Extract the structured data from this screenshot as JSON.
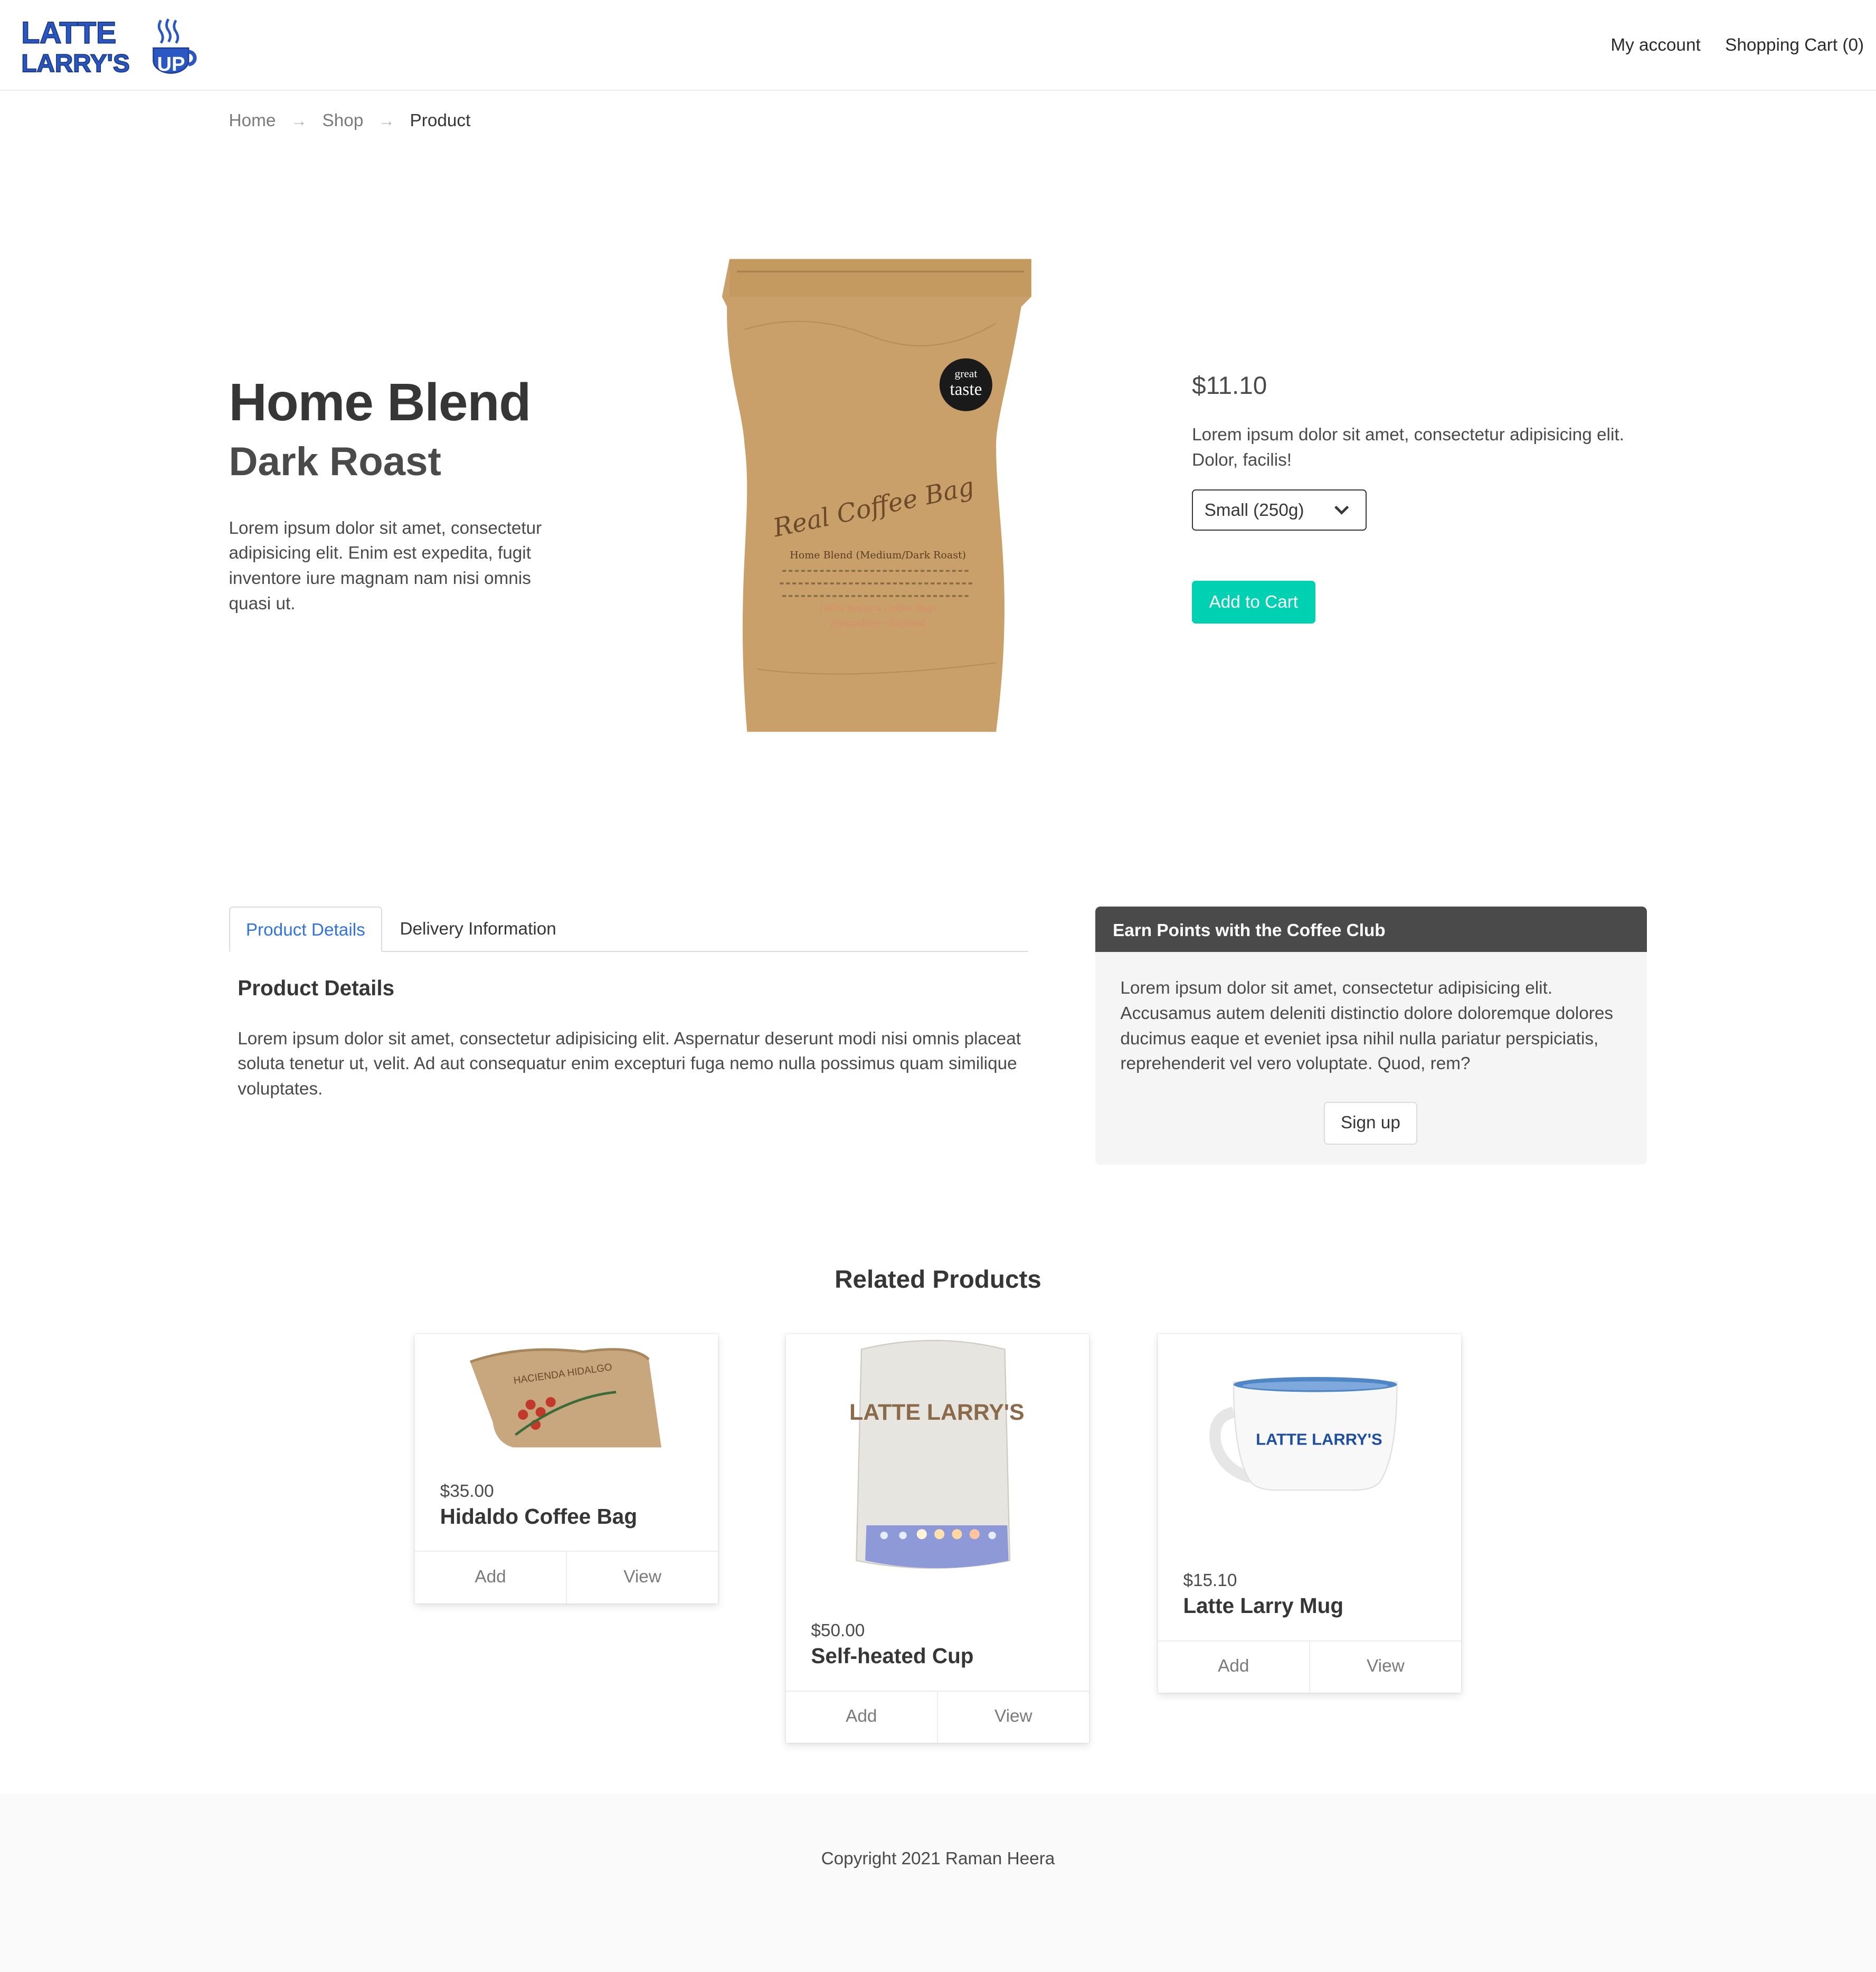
{
  "header": {
    "logo_line1": "LATTE",
    "logo_line2": "LARRY'S",
    "logo_cup_text": "UP",
    "my_account": "My account",
    "shopping_cart": "Shopping Cart (0)"
  },
  "breadcrumb": [
    "Home",
    "Shop",
    "Product"
  ],
  "product": {
    "title": "Home Blend",
    "subtitle": "Dark Roast",
    "description": "Lorem ipsum dolor sit amet, consectetur adipisicing elit. Enim est expedita, fugit inventore iure magnam nam nisi omnis quasi ut.",
    "image_label": {
      "badge_small": "great",
      "badge_big": "taste",
      "brand": "Real Coffee Bag",
      "line1": "Home Blend (Medium/Dark Roast)",
      "line2": "100% Arabica Coffee Bags",
      "line3": "Shropshire—England"
    },
    "price": "$11.10",
    "buy_description": "Lorem ipsum dolor sit amet, consectetur adipisicing elit. Dolor, facilis!",
    "size_selected": "Small (250g)",
    "add_to_cart": "Add to Cart"
  },
  "tabs": {
    "items": [
      "Product Details",
      "Delivery Information"
    ],
    "active": "Product Details",
    "heading": "Product Details",
    "body": "Lorem ipsum dolor sit amet, consectetur adipisicing elit. Aspernatur deserunt modi nisi omnis placeat soluta tenetur ut, velit. Ad aut consequatur enim excepturi fuga nemo nulla possimus quam similique voluptates."
  },
  "coffee_club": {
    "heading": "Earn Points with the Coffee Club",
    "body": "Lorem ipsum dolor sit amet, consectetur adipisicing elit. Accusamus autem deleniti distinctio dolore doloremque dolores ducimus eaque et eveniet ipsa nihil nulla pariatur perspiciatis, reprehenderit vel vero voluptate. Quod, rem?",
    "button": "Sign up"
  },
  "related": {
    "title": "Related Products",
    "items": [
      {
        "price": "$35.00",
        "name": "Hidaldo Coffee Bag",
        "add": "Add",
        "view": "View",
        "image_text": "HACIENDA HIDALGO"
      },
      {
        "price": "$50.00",
        "name": "Self-heated Cup",
        "add": "Add",
        "view": "View",
        "image_text": "LATTE LARRY'S"
      },
      {
        "price": "$15.10",
        "name": "Latte Larry Mug",
        "add": "Add",
        "view": "View",
        "image_text": "LATTE LARRY'S"
      }
    ]
  },
  "footer": {
    "copyright": "Copyright 2021 Raman Heera"
  },
  "colors": {
    "brand_blue": "#2a57c2",
    "accent_teal": "#00d1b2",
    "link_blue": "#3273dc",
    "club_header": "#4a4a4a"
  }
}
